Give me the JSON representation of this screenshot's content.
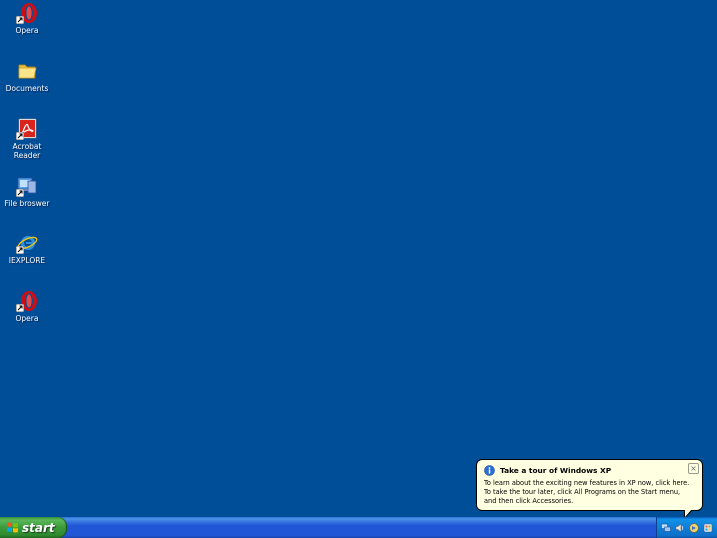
{
  "desktop": {
    "background": "#004e98",
    "icons": [
      {
        "label": "Opera",
        "icon": "opera-icon"
      },
      {
        "label": "Documents",
        "icon": "folder-icon"
      },
      {
        "label": "Acrobat\nReader",
        "icon": "acrobat-reader-icon"
      },
      {
        "label": "File broswer",
        "icon": "file-browser-icon"
      },
      {
        "label": "IEXPLORE",
        "icon": "internet-explorer-icon"
      },
      {
        "label": "Opera",
        "icon": "opera-icon"
      }
    ]
  },
  "balloon": {
    "title": "Take a tour of Windows XP",
    "line1": "To learn about the exciting new features in XP now, click here.",
    "line2": "To take the tour later, click All Programs on the Start menu,",
    "line3": "and then click Accessories.",
    "close_glyph": "×",
    "icon": "info-icon"
  },
  "taskbar": {
    "start_label": "start",
    "tray_icons": [
      "network-icon",
      "volume-icon",
      "tour-icon",
      "security-icon"
    ]
  }
}
